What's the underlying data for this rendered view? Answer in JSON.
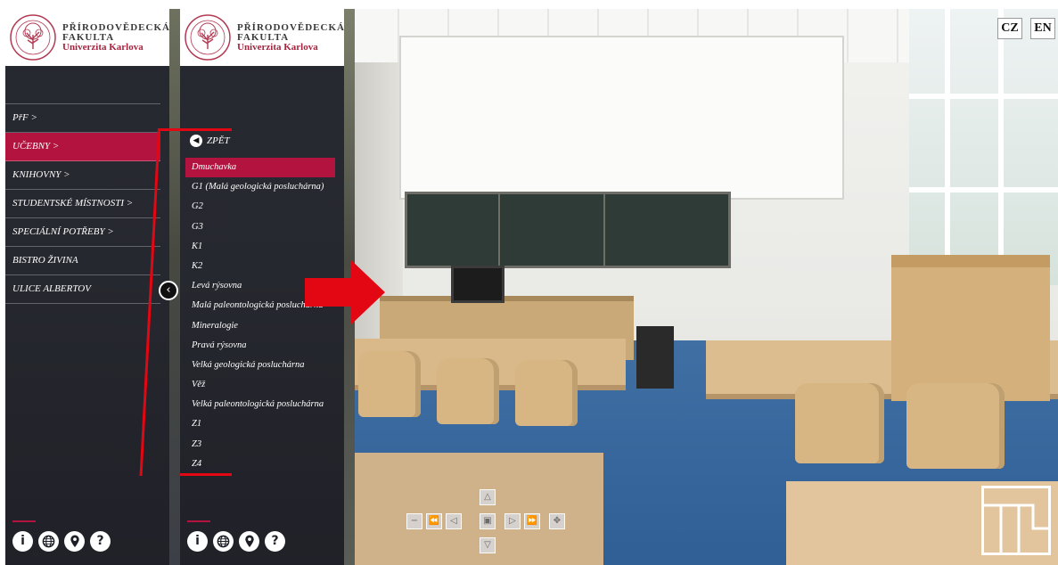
{
  "logo": {
    "line1": "PŘÍRODOVĚDECKÁ",
    "line2": "FAKULTA",
    "line3": "Univerzita Karlova",
    "seal_icon": "university-seal-icon",
    "accent_color": "#a4253f"
  },
  "main_menu": {
    "items": [
      {
        "label": "PřF >",
        "active": false
      },
      {
        "label": "UČEBNY >",
        "active": true
      },
      {
        "label": "KNIHOVNY >",
        "active": false
      },
      {
        "label": "STUDENTSKÉ MÍSTNOSTI >",
        "active": false
      },
      {
        "label": "SPECIÁLNÍ POTŘEBY >",
        "active": false
      },
      {
        "label": "BISTRO ŽIVINA",
        "active": false
      },
      {
        "label": "ULICE ALBERTOV",
        "active": false
      }
    ],
    "collapse_icon": "chevron-left-icon",
    "active_color": "#b3143f"
  },
  "submenu": {
    "back_label": "ZPĚT",
    "items": [
      {
        "label": "Dmuchavka",
        "active": true
      },
      {
        "label": "G1 (Malá geologická posluchárna)",
        "active": false
      },
      {
        "label": "G2",
        "active": false
      },
      {
        "label": "G3",
        "active": false
      },
      {
        "label": "K1",
        "active": false
      },
      {
        "label": "K2",
        "active": false
      },
      {
        "label": "Levá rýsovna",
        "active": false
      },
      {
        "label": "Malá paleontologická posluchárna",
        "active": false
      },
      {
        "label": "Mineralogie",
        "active": false
      },
      {
        "label": "Pravá rýsovna",
        "active": false
      },
      {
        "label": "Velká geologická posluchárna",
        "active": false
      },
      {
        "label": "Věž",
        "active": false
      },
      {
        "label": "Velká paleontologická posluchárna",
        "active": false
      },
      {
        "label": "Z1",
        "active": false
      },
      {
        "label": "Z3",
        "active": false
      },
      {
        "label": "Z4",
        "active": false
      }
    ]
  },
  "footer_icons": [
    {
      "name": "info-icon",
      "glyph": "i"
    },
    {
      "name": "globe-icon",
      "glyph": "🌐"
    },
    {
      "name": "map-pin-icon",
      "glyph": "⚲"
    },
    {
      "name": "help-icon",
      "glyph": "?"
    }
  ],
  "language": {
    "cz": "CZ",
    "en": "EN"
  },
  "navigation": {
    "up": "△",
    "down": "▽",
    "left": "◁",
    "right": "▷",
    "rewind": "⏪",
    "fast_forward": "⏩",
    "zoom_out": "−",
    "zoom_in": "+",
    "center": "▣",
    "fullscreen": "✥"
  },
  "annotation_color": "#e30613"
}
